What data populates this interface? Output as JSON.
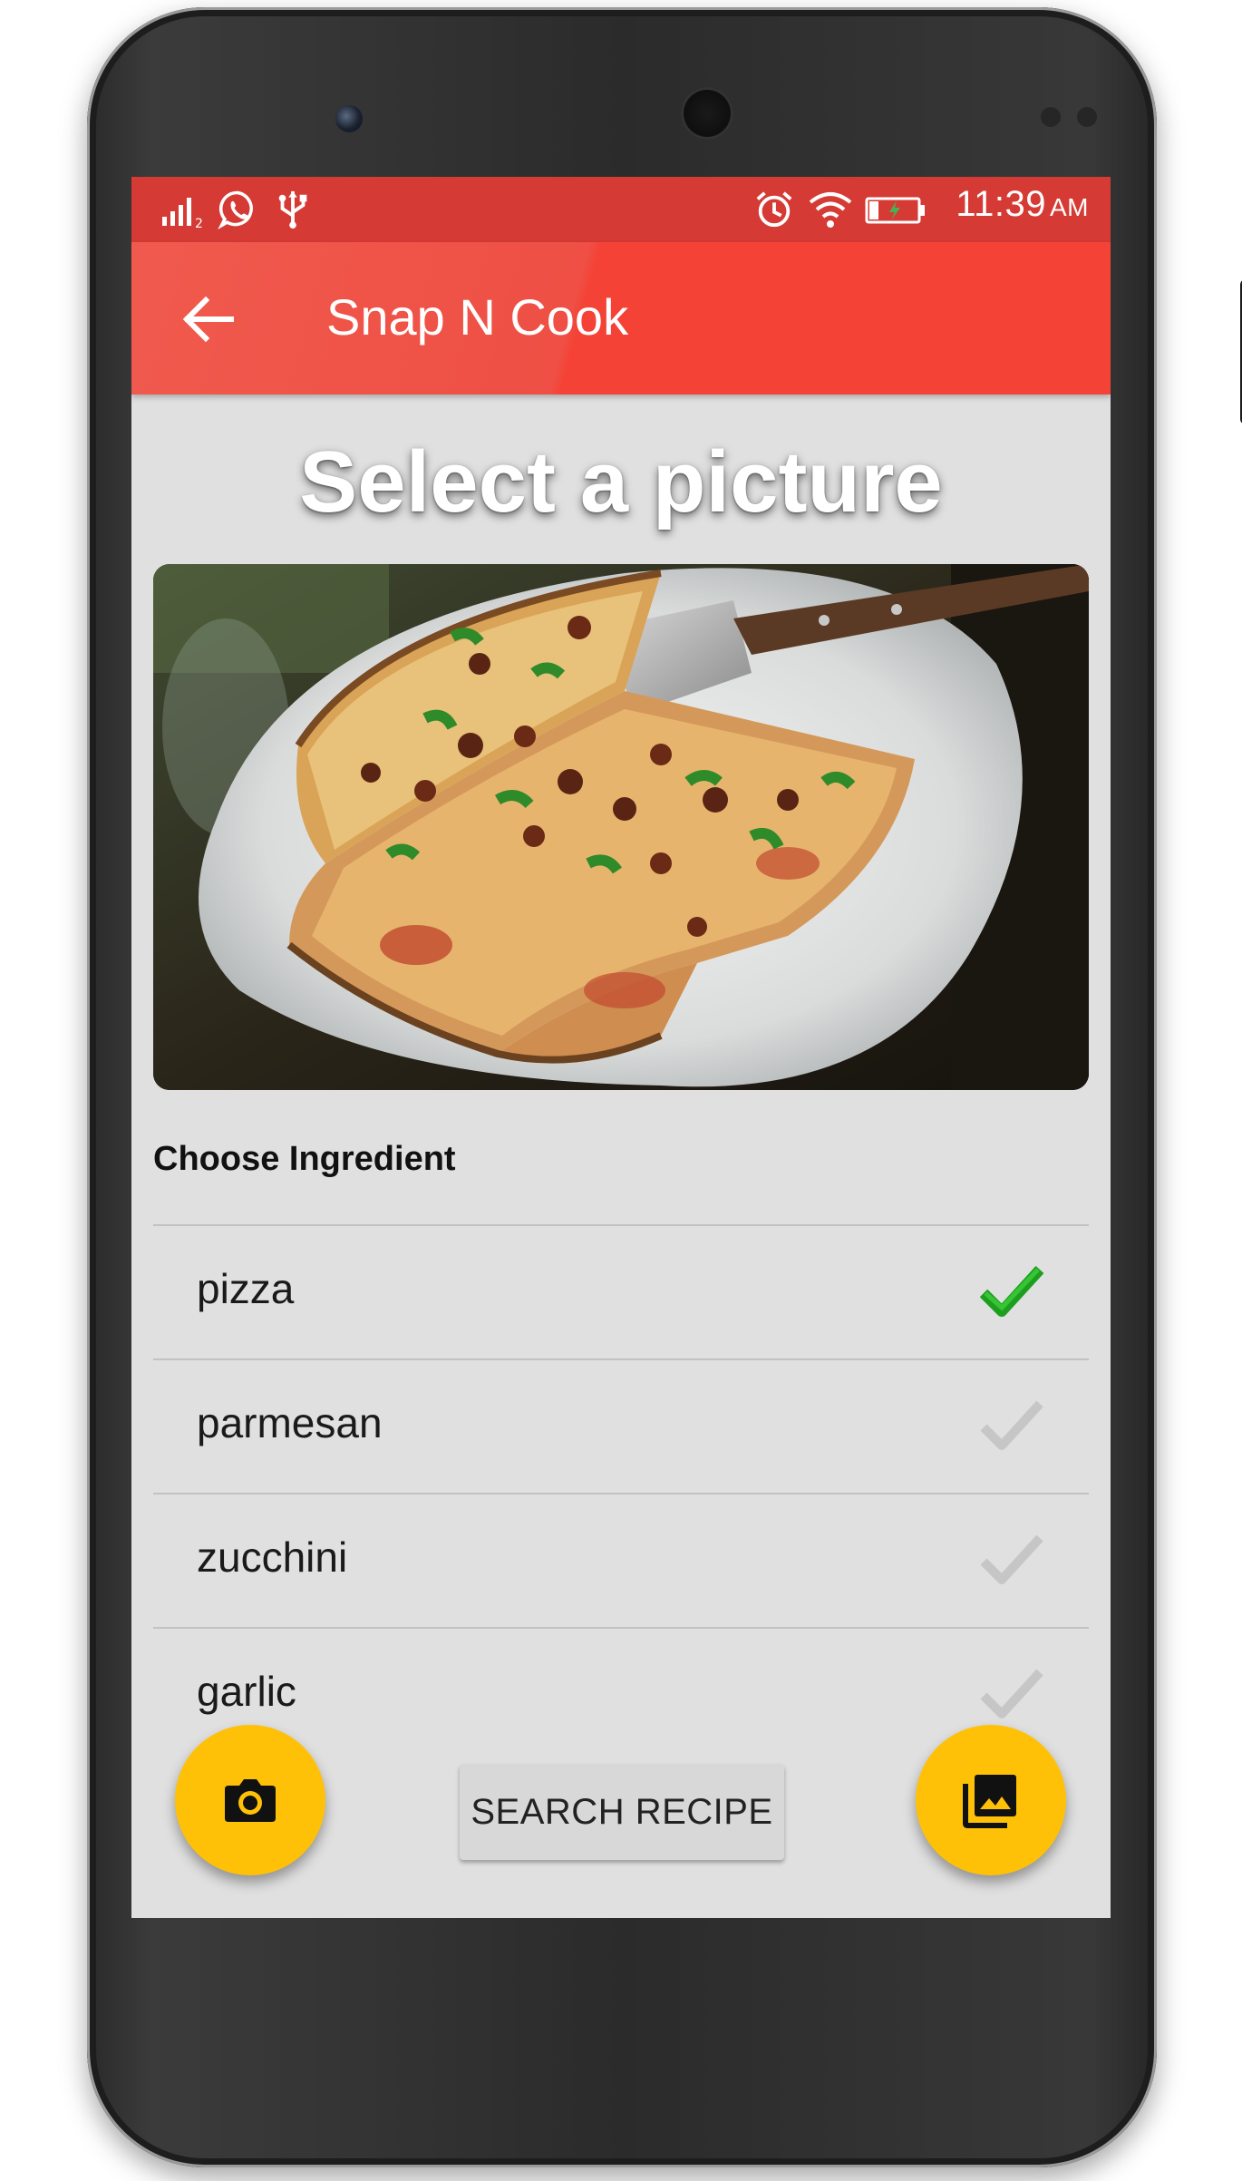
{
  "status_bar": {
    "time": "11:39",
    "ampm": "AM",
    "icons": [
      "signal-icon",
      "whatsapp-icon",
      "usb-icon",
      "alarm-icon",
      "wifi-icon",
      "battery-charging-icon"
    ]
  },
  "toolbar": {
    "back_icon": "arrow-back-icon",
    "title": "Snap N Cook"
  },
  "main": {
    "headline": "Select a picture",
    "photo_icon": "pizza-photo",
    "section_label": "Choose Ingredient",
    "ingredients": [
      {
        "name": "pizza",
        "selected": true
      },
      {
        "name": "parmesan",
        "selected": false
      },
      {
        "name": "zucchini",
        "selected": false
      },
      {
        "name": "garlic",
        "selected": false
      }
    ],
    "search_button": "SEARCH RECIPE",
    "camera_fab_icon": "camera-icon",
    "gallery_fab_icon": "photo-library-icon"
  },
  "colors": {
    "status_bar": "#d63a34",
    "toolbar": "#f44336",
    "fab": "#ffc107",
    "check_selected": "#22b022",
    "check_unselected": "#c8c8c8",
    "screen_bg": "#e0e0e0"
  }
}
